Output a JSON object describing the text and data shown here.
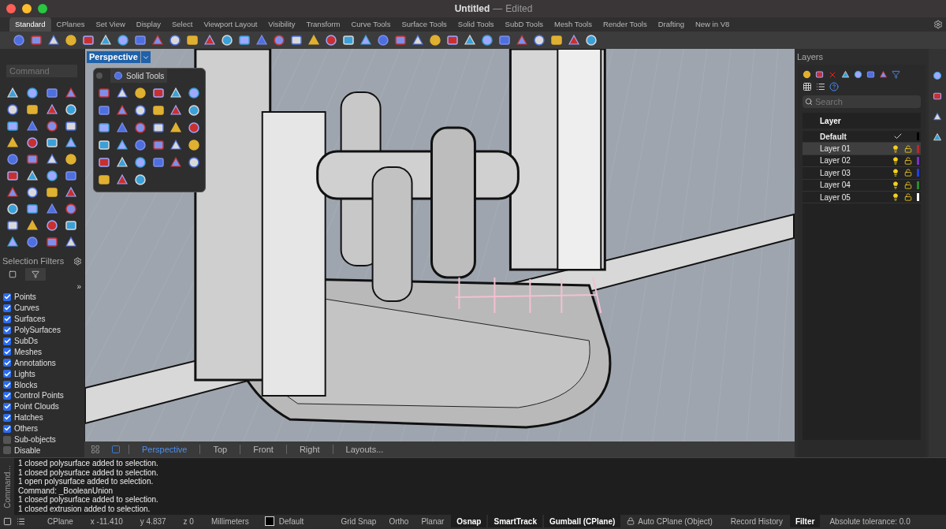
{
  "window": {
    "title": "Untitled",
    "separator": "—",
    "subtitle": "Edited"
  },
  "toolbar_tabs": [
    {
      "label": "Standard",
      "selected": true
    },
    {
      "label": "CPlanes",
      "selected": false
    },
    {
      "label": "Set View",
      "selected": false
    },
    {
      "label": "Display",
      "selected": false
    },
    {
      "label": "Select",
      "selected": false
    },
    {
      "label": "Viewport Layout",
      "selected": false
    },
    {
      "label": "Visibility",
      "selected": false
    },
    {
      "label": "Transform",
      "selected": false
    },
    {
      "label": "Curve Tools",
      "selected": false
    },
    {
      "label": "Surface Tools",
      "selected": false
    },
    {
      "label": "Solid Tools",
      "selected": false
    },
    {
      "label": "SubD Tools",
      "selected": false
    },
    {
      "label": "Mesh Tools",
      "selected": false
    },
    {
      "label": "Render Tools",
      "selected": false
    },
    {
      "label": "Drafting",
      "selected": false
    },
    {
      "label": "New in V8",
      "selected": false
    }
  ],
  "command_field": {
    "placeholder": "Command"
  },
  "viewport": {
    "name": "Perspective",
    "floating_panel": {
      "title": "Solid Tools"
    }
  },
  "selection_filters": {
    "title": "Selection Filters",
    "more": "»",
    "items": [
      {
        "label": "Points",
        "checked": true
      },
      {
        "label": "Curves",
        "checked": true
      },
      {
        "label": "Surfaces",
        "checked": true
      },
      {
        "label": "PolySurfaces",
        "checked": true
      },
      {
        "label": "SubDs",
        "checked": true
      },
      {
        "label": "Meshes",
        "checked": true
      },
      {
        "label": "Annotations",
        "checked": true
      },
      {
        "label": "Lights",
        "checked": true
      },
      {
        "label": "Blocks",
        "checked": true
      },
      {
        "label": "Control Points",
        "checked": true
      },
      {
        "label": "Point Clouds",
        "checked": true
      },
      {
        "label": "Hatches",
        "checked": true
      },
      {
        "label": "Others",
        "checked": true
      },
      {
        "label": "Sub-objects",
        "checked": false
      },
      {
        "label": "Disable",
        "checked": false
      }
    ]
  },
  "viewport_tabs": [
    {
      "label": "Perspective",
      "selected": true
    },
    {
      "label": "Top",
      "selected": false
    },
    {
      "label": "Front",
      "selected": false
    },
    {
      "label": "Right",
      "selected": false
    },
    {
      "label": "Layouts...",
      "selected": false
    }
  ],
  "layers": {
    "title": "Layers",
    "search_placeholder": "Search",
    "column": "Layer",
    "rows": [
      {
        "name": "Default",
        "current": true,
        "selected": false,
        "color": "#000000"
      },
      {
        "name": "Layer 01",
        "current": false,
        "selected": true,
        "color": "#c0262a"
      },
      {
        "name": "Layer 02",
        "current": false,
        "selected": false,
        "color": "#7b2fd0"
      },
      {
        "name": "Layer 03",
        "current": false,
        "selected": false,
        "color": "#1f3fe8"
      },
      {
        "name": "Layer 04",
        "current": false,
        "selected": false,
        "color": "#2f8a2f"
      },
      {
        "name": "Layer 05",
        "current": false,
        "selected": false,
        "color": "#ffffff"
      }
    ]
  },
  "command_history": {
    "label": "Command...",
    "lines": [
      "1 closed polysurface added to selection.",
      "1 closed polysurface added to selection.",
      "1 open polysurface added to selection.",
      "Command: _BooleanUnion",
      "1 closed polysurface added to selection.",
      "1 closed extrusion added to selection."
    ]
  },
  "status_bar": {
    "items": [
      {
        "kind": "text",
        "label": "CPlane"
      },
      {
        "kind": "text",
        "label": "x -11.410"
      },
      {
        "kind": "text",
        "label": "y 4.837"
      },
      {
        "kind": "text",
        "label": "z 0"
      },
      {
        "kind": "text",
        "label": "Millimeters"
      },
      {
        "kind": "layer",
        "label": "Default",
        "color": "#000000"
      },
      {
        "kind": "toggle",
        "label": "Grid Snap",
        "on": false
      },
      {
        "kind": "toggle",
        "label": "Ortho",
        "on": false
      },
      {
        "kind": "toggle",
        "label": "Planar",
        "on": false
      },
      {
        "kind": "toggle",
        "label": "Osnap",
        "on": true
      },
      {
        "kind": "toggle",
        "label": "SmartTrack",
        "on": true
      },
      {
        "kind": "toggle",
        "label": "Gumball (CPlane)",
        "on": true
      },
      {
        "kind": "locked",
        "label": "Auto CPlane (Object)"
      },
      {
        "kind": "toggle",
        "label": "Record History",
        "on": false
      },
      {
        "kind": "toggle",
        "label": "Filter",
        "on": true
      },
      {
        "kind": "text",
        "label": "Absolute tolerance: 0.0"
      }
    ]
  }
}
